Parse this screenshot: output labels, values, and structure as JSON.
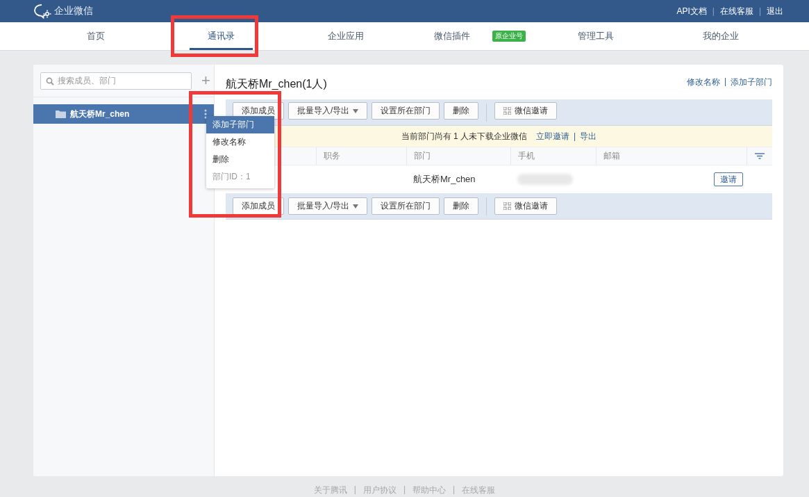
{
  "header": {
    "logo": "企业微信",
    "separator": "|",
    "links": [
      "API文档",
      "在线客服",
      "退出"
    ]
  },
  "nav": {
    "tabs": [
      {
        "label": "首页",
        "selected": false,
        "highlighted": false
      },
      {
        "label": "通讯录",
        "selected": true,
        "highlighted": true
      },
      {
        "label": "企业应用",
        "selected": false,
        "highlighted": false
      },
      {
        "label": "微信插件",
        "selected": false,
        "highlighted": false,
        "badge": "原企业号"
      },
      {
        "label": "管理工具",
        "selected": false,
        "highlighted": false
      },
      {
        "label": "我的企业",
        "selected": false,
        "highlighted": false
      }
    ]
  },
  "sidebar": {
    "search": {
      "placeholder": "搜索成员、部门"
    },
    "add": "+",
    "tree": [
      {
        "label": "航天桥Mr_chen",
        "selected": true
      }
    ]
  },
  "context_menu": {
    "highlighted": true,
    "items": [
      {
        "label": "添加子部门",
        "selected": true,
        "kind": "action"
      },
      {
        "label": "修改名称",
        "selected": false,
        "kind": "action"
      },
      {
        "label": "删除",
        "selected": false,
        "kind": "action"
      },
      {
        "label": "部门ID：1",
        "selected": false,
        "kind": "info"
      }
    ]
  },
  "department": {
    "title": "航天桥Mr_chen(1人)",
    "separator": "|",
    "links": [
      "修改名称",
      "添加子部门"
    ]
  },
  "toolbar_top": [
    {
      "label": "添加成员",
      "kind": "plain"
    },
    {
      "label": "批量导入/导出",
      "kind": "dropdown"
    },
    {
      "label": "设置所在部门",
      "kind": "plain"
    },
    {
      "label": "删除",
      "kind": "plain"
    },
    {
      "label": "微信邀请",
      "kind": "qr"
    }
  ],
  "notice": {
    "text": "当前部门尚有 1 人未下载企业微信",
    "separator": "|",
    "links": [
      "立即邀请",
      "导出"
    ]
  },
  "table": {
    "columns": [
      "职务",
      "部门",
      "手机",
      "邮箱"
    ],
    "rows": [
      {
        "department": "航天桥Mr_chen",
        "action": "邀请"
      }
    ]
  },
  "toolbar_bottom": [
    {
      "label": "添加成员",
      "kind": "plain"
    },
    {
      "label": "批量导入/导出",
      "kind": "dropdown"
    },
    {
      "label": "设置所在部门",
      "kind": "plain"
    },
    {
      "label": "删除",
      "kind": "plain"
    },
    {
      "label": "微信邀请",
      "kind": "qr"
    }
  ],
  "footer": {
    "separator": "|",
    "links": [
      "关于腾讯",
      "用户协议",
      "帮助中心",
      "在线客服"
    ]
  }
}
